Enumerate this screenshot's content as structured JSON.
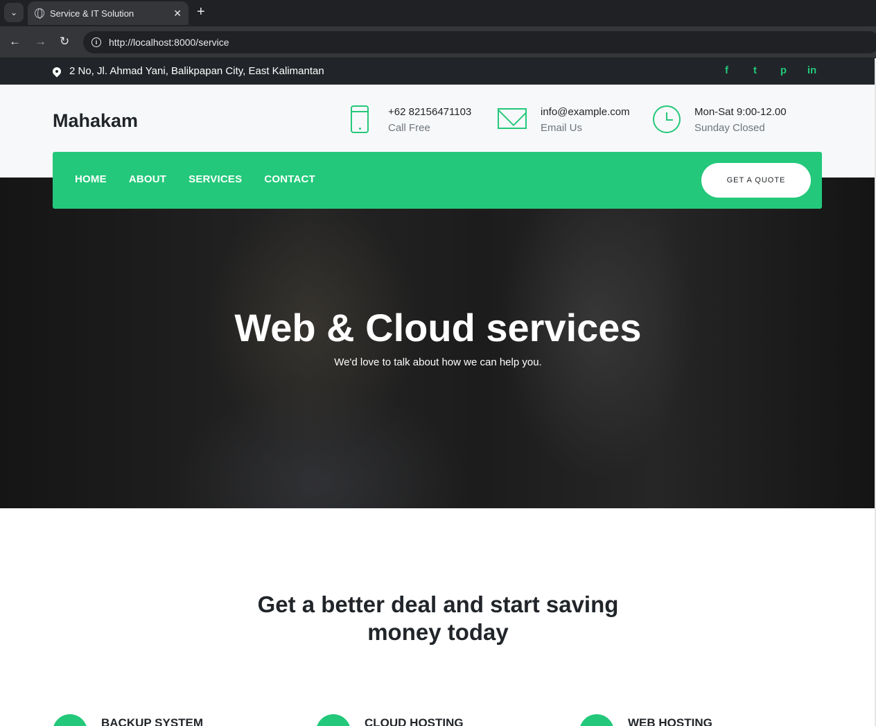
{
  "browser": {
    "tab_title": "Service & IT Solution",
    "url": "http://localhost:8000/service",
    "tab_close": "✕",
    "new_tab": "+",
    "back": "←",
    "forward": "→",
    "reload": "↻",
    "menu": "⌄",
    "info": "i"
  },
  "topbar": {
    "address": "2 No, Jl. Ahmad Yani, Balikpapan City, East Kalimantan",
    "socials": [
      {
        "icon": "facebook-icon",
        "glyph": "f"
      },
      {
        "icon": "twitter-icon",
        "glyph": "t"
      },
      {
        "icon": "pinterest-icon",
        "glyph": "p"
      },
      {
        "icon": "linkedin-icon",
        "glyph": "in"
      }
    ]
  },
  "header": {
    "logo": "Mahakam",
    "phone": {
      "line1": "+62 82156471103",
      "line2": "Call Free"
    },
    "email": {
      "line1": "info@example.com",
      "line2": "Email Us"
    },
    "hours": {
      "line1": "Mon-Sat 9:00-12.00",
      "line2": "Sunday Closed"
    }
  },
  "nav": {
    "items": [
      "HOME",
      "ABOUT",
      "SERVICES",
      "CONTACT"
    ],
    "quote_button": "GET A QUOTE"
  },
  "hero": {
    "title": "Web & Cloud services",
    "subtitle": "We'd love to talk about how we can help you."
  },
  "section": {
    "title_line1": "Get a better deal and start saving",
    "title_line2": "money today",
    "features": [
      "BACKUP SYSTEM",
      "CLOUD HOSTING",
      "WEB HOSTING"
    ]
  },
  "colors": {
    "accent": "#23c87a",
    "dark": "#212529"
  }
}
